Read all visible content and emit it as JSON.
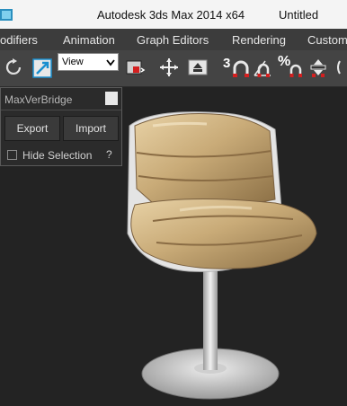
{
  "titlebar": {
    "title": "Autodesk 3ds Max  2014 x64",
    "document": "Untitled"
  },
  "menu": {
    "items": [
      "odifiers",
      "Animation",
      "Graph Editors",
      "Rendering",
      "Custom"
    ]
  },
  "toolbar": {
    "reference_coord_system": "View",
    "angle_snap_label": "3",
    "percent_snap_label": "%"
  },
  "plugin_panel": {
    "title": "MaxVerBridge",
    "export_label": "Export",
    "import_label": "Import",
    "hide_selection_label": "Hide Selection",
    "hide_selection_checked": false,
    "help_label": "?"
  },
  "viewport": {
    "background_color": "#232323",
    "object": "chair model"
  },
  "colors": {
    "titlebar_bg": "#f4f4f4",
    "menubar_bg": "#3c3c3c",
    "toolbar_bg": "#444444",
    "panel_bg": "#2b2b2b"
  }
}
